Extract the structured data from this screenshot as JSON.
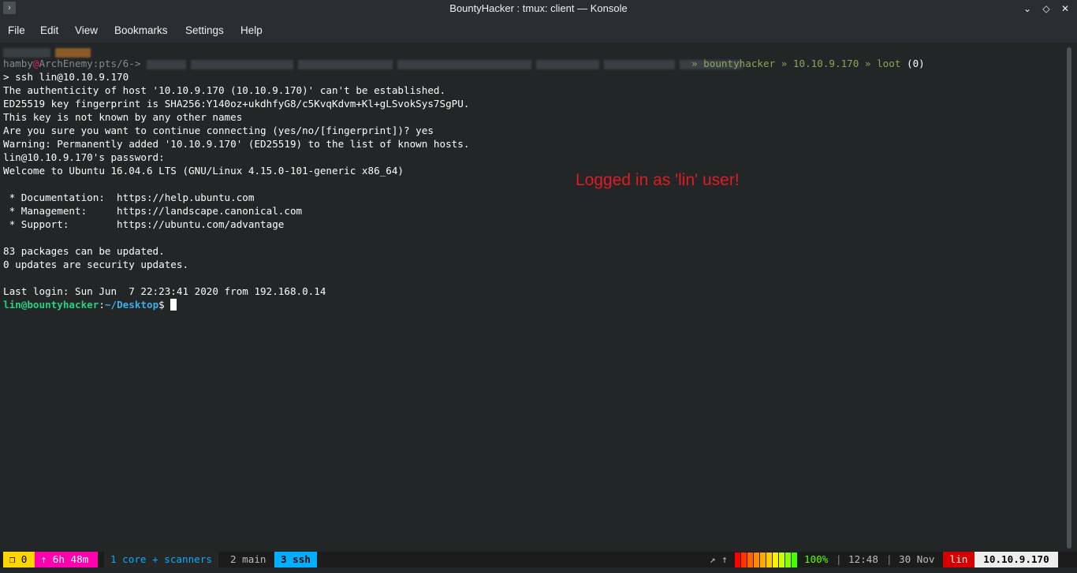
{
  "window": {
    "title": "BountyHacker : tmux: client — Konsole",
    "app_icon": "terminal-icon",
    "controls": [
      "chevron-down-icon",
      "diamond-icon",
      "close-icon"
    ]
  },
  "menu": [
    "File",
    "Edit",
    "View",
    "Bookmarks",
    "Settings",
    "Help"
  ],
  "terminal": {
    "prompt_user": "hamby",
    "prompt_at": "@",
    "prompt_host": "ArchEnemy",
    "prompt_tty": ":pts/6->",
    "path_segments": [
      "» bountyhacker",
      "» 10.10.9.170",
      "» loot"
    ],
    "path_count": "(0)",
    "lines": [
      "> ssh lin@10.10.9.170",
      "The authenticity of host '10.10.9.170 (10.10.9.170)' can't be established.",
      "ED25519 key fingerprint is SHA256:Y140oz+ukdhfyG8/c5KvqKdvm+Kl+gLSvokSys7SgPU.",
      "This key is not known by any other names",
      "Are you sure you want to continue connecting (yes/no/[fingerprint])? yes",
      "Warning: Permanently added '10.10.9.170' (ED25519) to the list of known hosts.",
      "lin@10.10.9.170's password:",
      "Welcome to Ubuntu 16.04.6 LTS (GNU/Linux 4.15.0-101-generic x86_64)",
      "",
      " * Documentation:  https://help.ubuntu.com",
      " * Management:     https://landscape.canonical.com",
      " * Support:        https://ubuntu.com/advantage",
      "",
      "83 packages can be updated.",
      "0 updates are security updates.",
      "",
      "Last login: Sun Jun  7 22:23:41 2020 from 192.168.0.14"
    ],
    "final_prompt_user": "lin@bountyhacker",
    "final_prompt_sep": ":",
    "final_prompt_path": "~/Desktop",
    "final_prompt_dollar": "$ ",
    "annotation": "Logged in as 'lin' user!"
  },
  "status": {
    "session_icon": "❐",
    "session_count": "0",
    "uptime": "↑ 6h 48m",
    "windows": [
      {
        "label": "1 core + scanners"
      },
      {
        "label": "2 main"
      },
      {
        "label": "3 ssh"
      }
    ],
    "net_arrows": "↗ ↑",
    "battery": "100%",
    "battery_level": 1.0,
    "time": "12:48",
    "date": "30 Nov",
    "user": "lin",
    "ip": "10.10.9.170",
    "sep1": "|",
    "sep2": "|"
  },
  "colors": {
    "background": "#232627",
    "status_yellow": "#ffd700",
    "status_pink": "#ff00af",
    "status_blue": "#00afff",
    "status_red": "#d70000",
    "annotation_red": "#e01b24"
  }
}
